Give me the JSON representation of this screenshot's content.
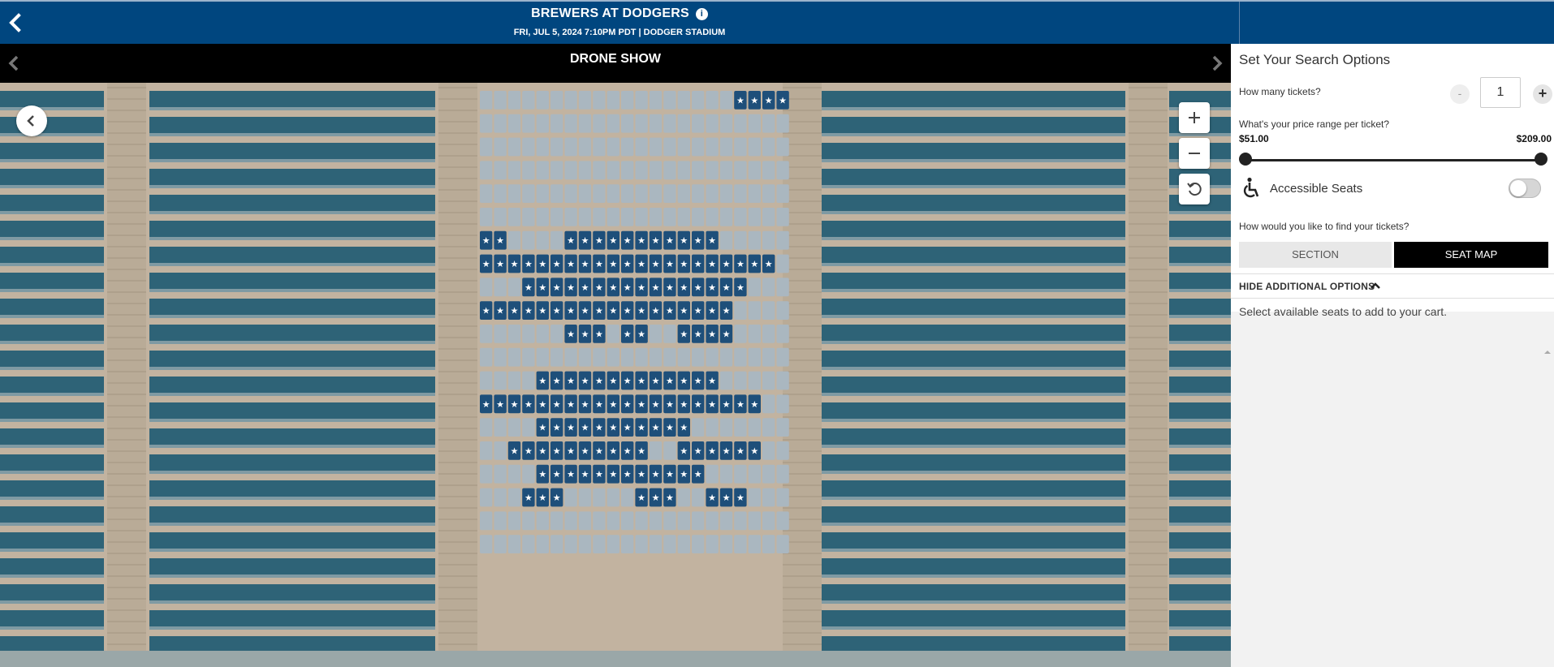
{
  "header": {
    "title": "BREWERS AT DODGERS",
    "info_glyph": "i",
    "subtitle": "FRI, JUL 5, 2024 7:10PM PDT | DODGER STADIUM"
  },
  "map": {
    "section_label": "DRONE SHOW",
    "zoom_in": "+",
    "zoom_out": "−",
    "colors": {
      "available": "#1e4f7a",
      "unavailable": "#aab7c0",
      "teal_seats": "#2e6377",
      "concrete": "#c2b3a0"
    }
  },
  "panel": {
    "title": "Set Your Search Options",
    "tickets_question": "How many tickets?",
    "minus_label": "-",
    "quantity": "1",
    "plus_label": "+",
    "price_question": "What's your price range per ticket?",
    "price_min": "$51.00",
    "price_max": "$209.00",
    "price_range_fraction": [
      0,
      1
    ],
    "accessible_label": "Accessible Seats",
    "accessible_on": false,
    "find_question": "How would you like to find your tickets?",
    "tab_section": "SECTION",
    "tab_seat_map": "SEAT MAP",
    "selected_tab": "SEAT MAP",
    "hide_options": "HIDE ADDITIONAL OPTIONS",
    "note": "Select available seats to add to your cart."
  }
}
